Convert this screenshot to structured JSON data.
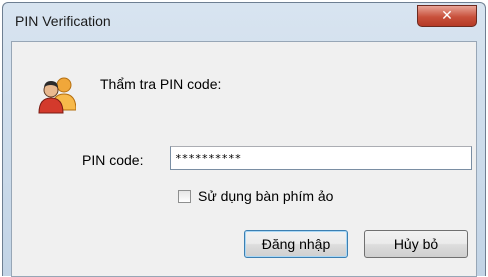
{
  "window": {
    "title": "PIN Verification"
  },
  "header": {
    "text": "Thẩm tra PIN code:"
  },
  "form": {
    "pin_label": "PIN code:",
    "pin_value": "**********",
    "virtual_keyboard_label": "Sử dụng bàn phím ảo",
    "virtual_keyboard_checked": false
  },
  "buttons": {
    "login": "Đăng nhập",
    "cancel": "Hủy bỏ"
  },
  "icons": {
    "close": "close-icon",
    "users": "users-icon"
  },
  "colors": {
    "close_button": "#c8503b",
    "title_bar": "#d8e4f0",
    "dialog_bg": "#f0f0f0"
  }
}
